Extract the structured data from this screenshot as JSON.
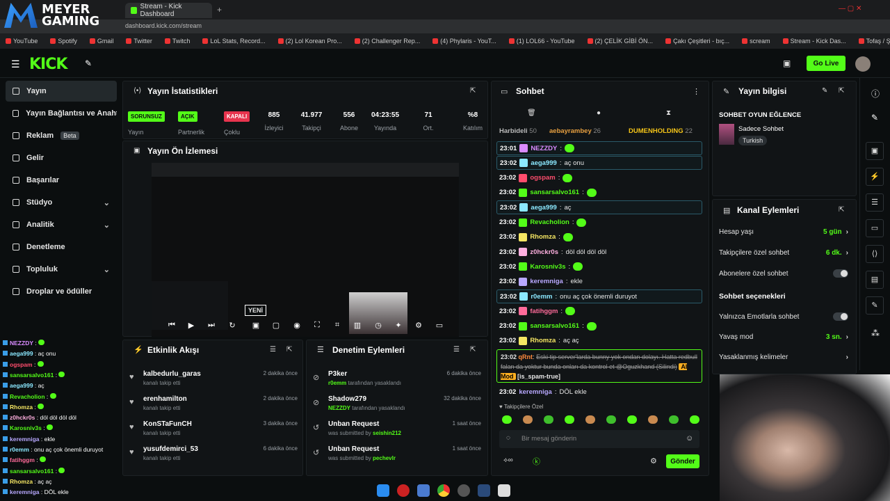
{
  "browser": {
    "tab_title": "Stream - Kick Dashboard",
    "url": "dashboard.kick.com/stream",
    "bookmarks": [
      "YouTube",
      "Spotify",
      "Gmail",
      "Twitter",
      "Twitch",
      "LoL Stats, Record...",
      "(2) Lol Korean Pro...",
      "(2) Challenger Rep...",
      "(4) Phylaris - YouT...",
      "(1) LOL66 - YouTube",
      "(2) ÇELİK GİBİ ÖN...",
      "Çakı Çeşitleri - bıç...",
      "scream",
      "Stream - Kick Das...",
      "Tofaş / Şahin / S /..."
    ]
  },
  "overlay_logo": {
    "line1": "MEYER",
    "line2": "GAMING"
  },
  "kick": {
    "logo": "KICK",
    "go_live": "Go Live"
  },
  "sidebar": [
    {
      "label": "Yayın"
    },
    {
      "label": "Yayın Bağlantısı ve Anahtarı"
    },
    {
      "label": "Reklam",
      "badge": "Beta"
    },
    {
      "label": "Gelir"
    },
    {
      "label": "Başarılar"
    },
    {
      "label": "Stüdyo"
    },
    {
      "label": "Analitik"
    },
    {
      "label": "Denetleme"
    },
    {
      "label": "Topluluk"
    },
    {
      "label": "Droplar ve ödüller"
    }
  ],
  "stats": {
    "title": "Yayın İstatistikleri",
    "badges": [
      {
        "text": "SORUNSUZ",
        "label": "Yayın",
        "color": "#53fc18"
      },
      {
        "text": "AÇIK",
        "label": "Partnerlik",
        "color": "#53fc18"
      },
      {
        "text": "KAPALI",
        "label": "Çoklu",
        "color": "#e8344e"
      }
    ],
    "values": [
      {
        "v": "885",
        "l": "İzleyici"
      },
      {
        "v": "41.977",
        "l": "Takipçi"
      },
      {
        "v": "556",
        "l": "Abone"
      },
      {
        "v": "04:23:55",
        "l": "Yayında"
      },
      {
        "v": "71",
        "l": "Ort."
      },
      {
        "v": "%8",
        "l": "Katılım"
      }
    ]
  },
  "preview": {
    "title": "Yayın Ön İzlemesi",
    "new_badge": "YENİ"
  },
  "activity": {
    "title": "Etkinlik Akışı",
    "rows": [
      {
        "name": "kalbedurlu_garas",
        "sub": "kanalı takip etti",
        "time": "2 dakika önce"
      },
      {
        "name": "erenhamilton",
        "sub": "kanalı takip etti",
        "time": "2 dakika önce"
      },
      {
        "name": "KonSTaFunCH",
        "sub": "kanalı takip etti",
        "time": "3 dakika önce"
      },
      {
        "name": "yusufdemirci_53",
        "sub": "kanalı takip etti",
        "time": "6 dakika önce"
      }
    ]
  },
  "moderation": {
    "title": "Denetim Eylemleri",
    "rows": [
      {
        "name": "P3ker",
        "who": "r0emm",
        "sub": "tarafından yasaklandı",
        "time": "6 dakika önce"
      },
      {
        "name": "Shadow279",
        "who": "NEZZDY",
        "sub": "tarafından yasaklandı",
        "time": "32 dakika önce"
      },
      {
        "name": "Unban Request",
        "who": "seishin212",
        "sub": "was submitted by",
        "time": "1 saat önce"
      },
      {
        "name": "Unban Request",
        "who": "pechevlr",
        "sub": "was submitted by",
        "time": "1 saat önce"
      }
    ]
  },
  "chat": {
    "title": "Sohbet",
    "pinned": [
      {
        "name": "Harbideli",
        "n": "50"
      },
      {
        "name": "aebayrambey",
        "n": "26"
      },
      {
        "name": "DUMENHOLDING",
        "n": "22"
      }
    ],
    "messages": [
      {
        "ts": "23:01",
        "user": "NEZZDY",
        "text": "",
        "color": "#d98bff",
        "hl": true,
        "emote": true
      },
      {
        "ts": "23:02",
        "user": "aega999",
        "text": "aç onu",
        "color": "#8be8ff",
        "hl": true
      },
      {
        "ts": "23:02",
        "user": "ogspam",
        "text": "",
        "color": "#ff4d6d",
        "emote": true
      },
      {
        "ts": "23:02",
        "user": "sansarsalvo161",
        "text": "",
        "color": "#53fc18",
        "emote": true
      },
      {
        "ts": "23:02",
        "user": "aega999",
        "text": "aç",
        "color": "#8be8ff",
        "hl": true
      },
      {
        "ts": "23:02",
        "user": "Revacholion",
        "text": "",
        "color": "#53fc18",
        "emote": true
      },
      {
        "ts": "23:02",
        "user": "Rhomza",
        "text": "",
        "color": "#f5e663",
        "emote": true
      },
      {
        "ts": "23:02",
        "user": "z0hckr0s",
        "text": "döl döl döl döl",
        "color": "#ffb0e0"
      },
      {
        "ts": "23:02",
        "user": "Karosniv3s",
        "text": "",
        "color": "#53fc18",
        "emote": true
      },
      {
        "ts": "23:02",
        "user": "keremniga",
        "text": "ekle",
        "color": "#b8a8ff"
      },
      {
        "ts": "23:02",
        "user": "r0emm",
        "text": "onu aç çok önemli duruyot",
        "color": "#8be8ff",
        "hl": true
      },
      {
        "ts": "23:02",
        "user": "fatihggm",
        "text": "",
        "color": "#ff6b9a",
        "emote": true
      },
      {
        "ts": "23:02",
        "user": "sansarsalvo161",
        "text": "",
        "color": "#53fc18",
        "emote": true
      },
      {
        "ts": "23:02",
        "user": "Rhomza",
        "text": "aç aç",
        "color": "#f5e663"
      }
    ],
    "deleted": {
      "ts": "23:02",
      "user": "qRnt",
      "text": "Eski tip server'larda bunny yok ondan dolayı. Hatta redbull falan da yoktur bunda onları da kontrol et @Oguzkhand (Silindi)",
      "mod": "AI Mod",
      "tag": "[is_spam-true]"
    },
    "last": {
      "ts": "23:02",
      "user": "keremniga",
      "text": "DÖL ekle"
    },
    "followers_only": "Takipçilere Özel",
    "placeholder": "Bir mesaj gönderin",
    "send": "Gönder"
  },
  "stream_info": {
    "title": "Yayın bilgisi",
    "stream_title": "SOHBET OYUN EĞLENCE",
    "category": "Sadece Sohbet",
    "language": "Turkish"
  },
  "channel_actions": {
    "title": "Kanal Eylemleri",
    "rows": [
      {
        "label": "Hesap yaşı",
        "value": "5 gün"
      },
      {
        "label": "Takipçilere özel sohbet",
        "value": "6 dk."
      },
      {
        "label": "Abonelere özel sohbet",
        "toggle": true
      }
    ],
    "section": "Sohbet seçenekleri",
    "rows2": [
      {
        "label": "Yalnızca Emotlarla sohbet",
        "toggle": true
      },
      {
        "label": "Yavaş mod",
        "value": "3 sn."
      },
      {
        "label": "Yasaklanmış kelimeler",
        "value": ""
      }
    ]
  },
  "left_chat": [
    {
      "u": "NEZZDY",
      "t": "",
      "c": "#d98bff"
    },
    {
      "u": "aega999",
      "t": "aç onu",
      "c": "#8be8ff"
    },
    {
      "u": "ogspam",
      "t": "",
      "c": "#ff4d6d"
    },
    {
      "u": "sansarsalvo161",
      "t": "",
      "c": "#53fc18"
    },
    {
      "u": "aega999",
      "t": "aç",
      "c": "#8be8ff"
    },
    {
      "u": "Revacholion",
      "t": "",
      "c": "#53fc18"
    },
    {
      "u": "Rhomza",
      "t": "",
      "c": "#f5e663"
    },
    {
      "u": "z0hckr0s",
      "t": "döl döl döl döl",
      "c": "#ffb0e0"
    },
    {
      "u": "Karosniv3s",
      "t": "",
      "c": "#53fc18"
    },
    {
      "u": "keremniga",
      "t": "ekle",
      "c": "#b8a8ff"
    },
    {
      "u": "r0emm",
      "t": "onu aç çok önemli duruyot",
      "c": "#8be8ff"
    },
    {
      "u": "fatihggm",
      "t": "",
      "c": "#ff6b9a"
    },
    {
      "u": "sansarsalvo161",
      "t": "",
      "c": "#53fc18"
    },
    {
      "u": "Rhomza",
      "t": "aç aç",
      "c": "#f5e663"
    },
    {
      "u": "keremniga",
      "t": "DÖL ekle",
      "c": "#b8a8ff"
    }
  ]
}
